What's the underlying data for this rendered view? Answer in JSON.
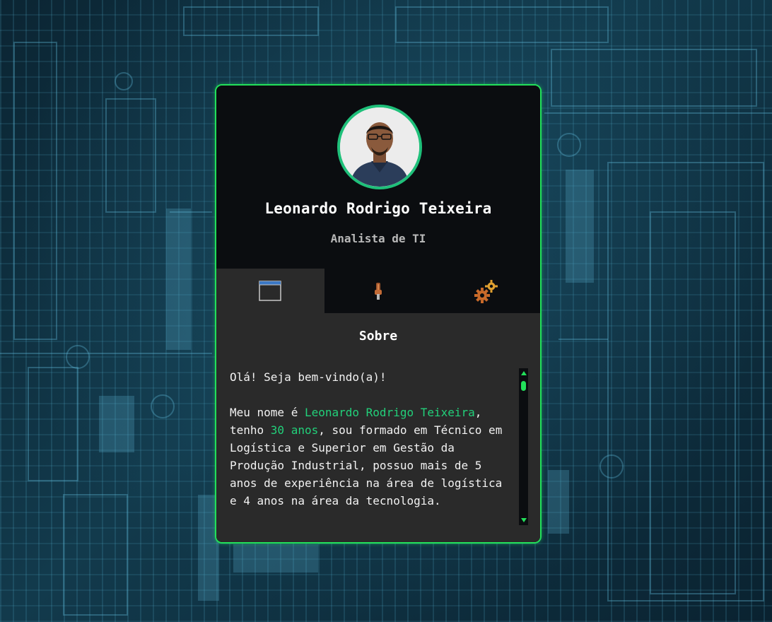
{
  "profile": {
    "name": "Leonardo Rodrigo Teixeira",
    "role": "Analista de TI"
  },
  "tabs": [
    {
      "icon": "window-icon",
      "active": true
    },
    {
      "icon": "thermometer-icon",
      "active": false
    },
    {
      "icon": "gears-icon",
      "active": false
    }
  ],
  "about": {
    "title": "Sobre",
    "greeting": "Olá! Seja bem-vindo(a)!",
    "p1_a": "Meu nome é ",
    "p1_name": "Leonardo Rodrigo Teixeira",
    "p1_b": ", tenho ",
    "p1_age": "30 anos",
    "p1_c": ", sou formado em Técnico em Logística e Superior em Gestão da Produção Industrial, possuo mais de 5 anos de experiência na área de logística e 4 anos na área da tecnologia."
  },
  "colors": {
    "accent": "#22e05a",
    "highlight": "#22d07a",
    "avatar_ring": "#1fc07a",
    "card_bg": "#0b0d10",
    "panel_bg": "#2a2a2a"
  }
}
